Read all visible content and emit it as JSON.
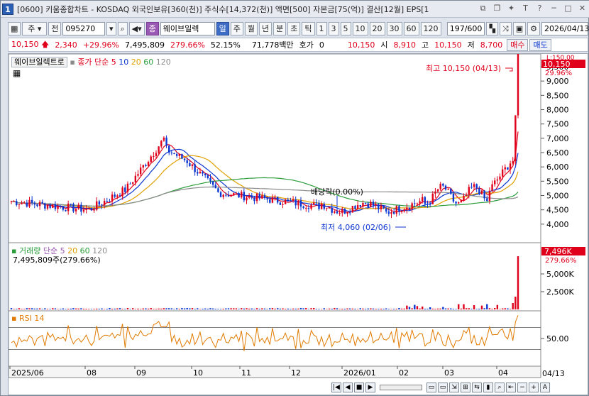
{
  "title": {
    "win_number": "1",
    "text": "[0600] 키움종합차트 - KOSDAQ 외국인보유[360(천)] 주식수[14,372(천)] 액면[500] 자본금[75(억)] 결산[12월] EPS[1"
  },
  "toolbar": {
    "period_type": "주",
    "all_label": "전",
    "code": "095270",
    "stock_name": "웨이브일렉",
    "periods": [
      "일",
      "주",
      "월",
      "년",
      "분",
      "초",
      "틱"
    ],
    "intervals": [
      "1",
      "3",
      "5",
      "10",
      "20",
      "30",
      "60",
      "120"
    ],
    "count": "197/600",
    "date": "2026/04/13"
  },
  "quote": {
    "price": "10,150",
    "change": "2,340",
    "change_pct": "+29.96%",
    "volume": "7,495,809",
    "volume_pct": "279.66%",
    "turnover": "52.15%",
    "amount": "71,778백만",
    "hoga_label": "호가",
    "hoga": "0",
    "open_price": "10,150",
    "open_label": "시",
    "open_val": "8,910",
    "high_label": "고",
    "high_val": "10,150",
    "low_label": "저",
    "low_val": "8,700",
    "buy": "매수",
    "sell": "매도"
  },
  "price_panel": {
    "name": "웨이브일렉트로",
    "ma_label": "종가 단순",
    "ma_periods": [
      "5",
      "10",
      "20",
      "60",
      "120"
    ],
    "ma_colors": [
      "#e0001b",
      "#0a36d1",
      "#e0a000",
      "#2a9d3a",
      "#8b8b8b"
    ],
    "current_label": "10,150",
    "current_pct": "29.96%",
    "top_label": "L:150.00",
    "y_ticks": [
      "9,500",
      "9,000",
      "8,500",
      "8,000",
      "7,500",
      "7,000",
      "6,500",
      "6,000",
      "5,500",
      "5,000",
      "4,500",
      "4,000"
    ],
    "high_annot": "최고 10,150 (04/13)",
    "low_annot": "최저 4,060 (02/06)",
    "dividend_annot": "배당락(0.00%)"
  },
  "volume_panel": {
    "name": "거래량",
    "ma_label": "단순",
    "ma_periods": [
      "5",
      "20",
      "60",
      "120"
    ],
    "value_text": "7,495,809주(279.66%)",
    "current_label": "7,496K",
    "current_pct": "279.66%",
    "y_ticks": [
      "5,000K",
      "2,500K"
    ]
  },
  "rsi_panel": {
    "name": "RSI 14",
    "y_ticks": [
      "50.00"
    ]
  },
  "x_axis": {
    "labels": [
      "2025/06",
      "08",
      "09",
      "10",
      "11",
      "12",
      "2026/01",
      "02",
      "03",
      "04"
    ],
    "end_label": "04/13"
  }
}
